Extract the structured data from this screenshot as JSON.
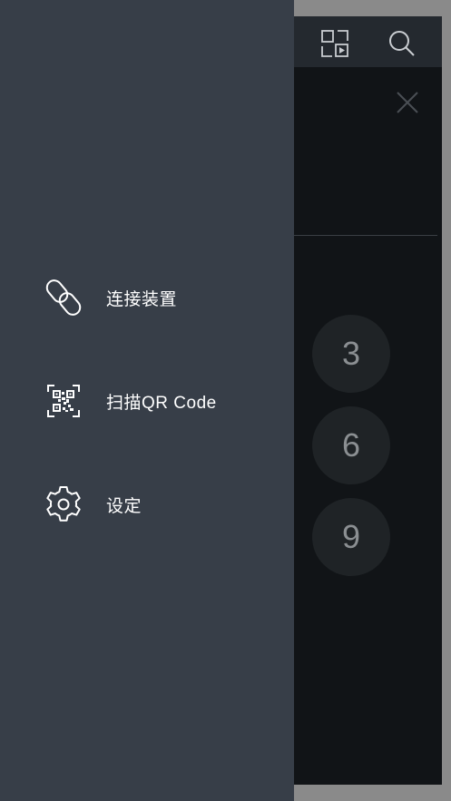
{
  "drawer": {
    "items": [
      {
        "label": "连接装置",
        "icon": "link-icon"
      },
      {
        "label": "扫描QR Code",
        "icon": "qr-code-icon"
      },
      {
        "label": "设定",
        "icon": "gear-icon"
      }
    ]
  },
  "background": {
    "topbar_icons": [
      "gallery-play-icon",
      "search-icon"
    ],
    "keypad_keys": [
      "3",
      "6",
      "9"
    ]
  },
  "colors": {
    "drawer_bg": "#373e48",
    "app_bg": "#111417",
    "topbar_bg": "#24292f",
    "key_bg": "#1f2326"
  }
}
